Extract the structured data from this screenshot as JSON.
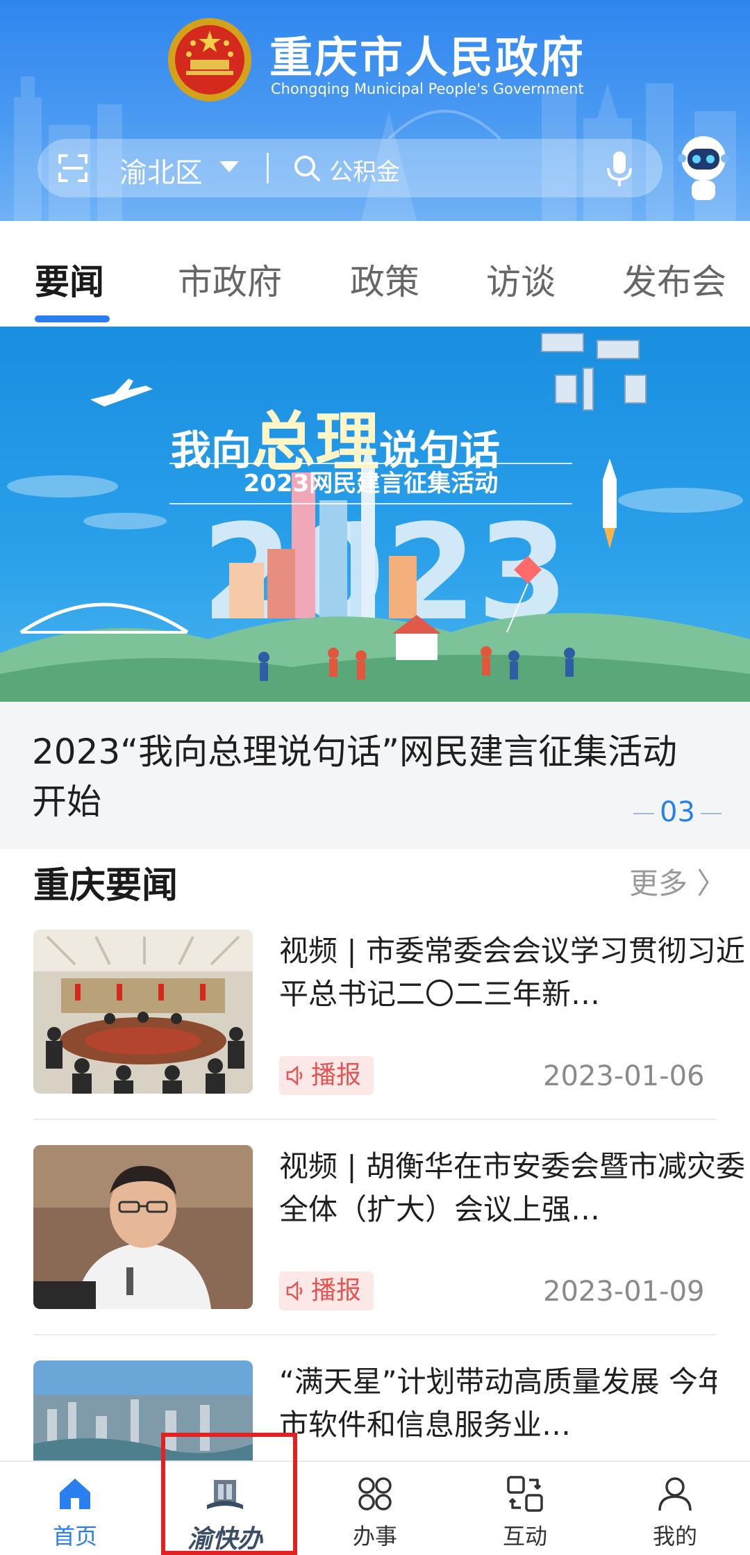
{
  "header": {
    "title_cn": "重庆市人民政府",
    "title_en": "Chongqing Municipal People's Government",
    "district": "渝北区",
    "search_placeholder": "公积金"
  },
  "tabs": [
    {
      "label": "要闻",
      "active": true
    },
    {
      "label": "市政府",
      "active": false
    },
    {
      "label": "政策",
      "active": false
    },
    {
      "label": "访谈",
      "active": false
    },
    {
      "label": "发布会",
      "active": false
    }
  ],
  "banner": {
    "title_pre": "我向",
    "title_big": "总理",
    "title_post": "说句话",
    "subtitle": "2023网民建言征集活动",
    "big_year": "2023",
    "caption": "2023“我向总理说句话”网民建言征集活动开始",
    "page_indicator": "03"
  },
  "section": {
    "title": "重庆要闻",
    "more": "更多 〉"
  },
  "news": [
    {
      "title": "视频 | 市委常委会会议学习贯彻习近平总书记二〇二三年新…",
      "tag": "播报",
      "date": "2023-01-06"
    },
    {
      "title": "视频 | 胡衡华在市安委会暨市减灾委全体（扩大）会议上强…",
      "tag": "播报",
      "date": "2023-01-09"
    },
    {
      "title": "“满天星”计划带动高质量发展 今年全市软件和信息服务业…"
    }
  ],
  "bottom_nav": [
    {
      "label": "首页",
      "icon": "home-icon",
      "active": true
    },
    {
      "label": "渝快办",
      "icon": "yukuaiban-logo-icon",
      "active": false
    },
    {
      "label": "办事",
      "icon": "services-grid-icon",
      "active": false
    },
    {
      "label": "互动",
      "icon": "interaction-icon",
      "active": false
    },
    {
      "label": "我的",
      "icon": "user-icon",
      "active": false
    }
  ],
  "colors": {
    "accent": "#2a7ff0",
    "header_blue": "#3a8ef0",
    "tag_red": "#e25555",
    "highlight_red": "#e02222"
  }
}
